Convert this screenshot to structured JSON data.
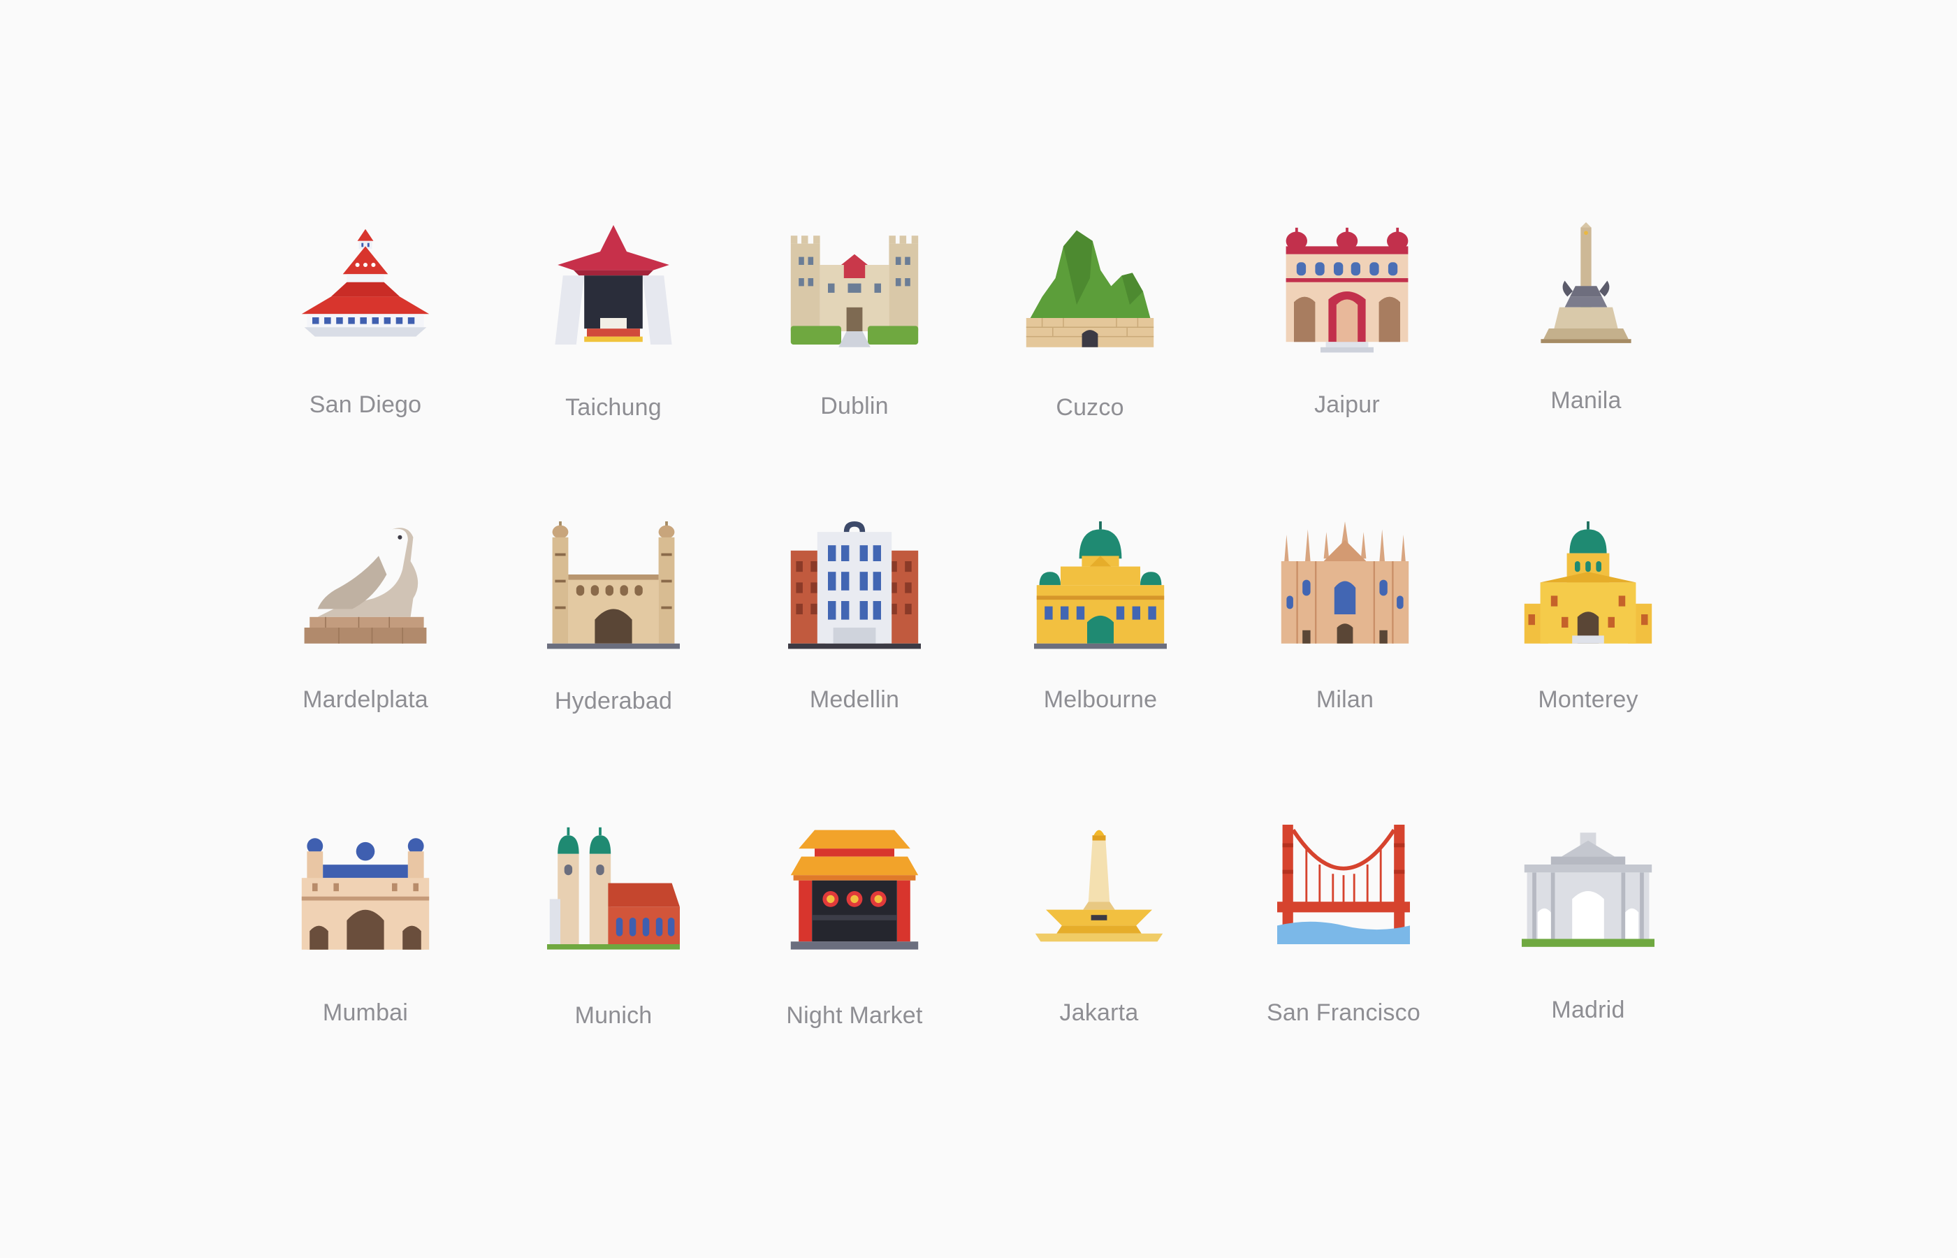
{
  "cities": [
    {
      "name": "San Diego",
      "icon": "san-diego-hotel-icon"
    },
    {
      "name": "Taichung",
      "icon": "taichung-pagoda-icon"
    },
    {
      "name": "Dublin",
      "icon": "dublin-castle-icon"
    },
    {
      "name": "Cuzco",
      "icon": "cuzco-machu-picchu-icon"
    },
    {
      "name": "Jaipur",
      "icon": "jaipur-palace-icon"
    },
    {
      "name": "Manila",
      "icon": "manila-rizal-monument-icon"
    },
    {
      "name": "Mardelplata",
      "icon": "mardelplata-sea-lion-icon"
    },
    {
      "name": "Hyderabad",
      "icon": "hyderabad-charminar-icon"
    },
    {
      "name": "Medellin",
      "icon": "medellin-building-icon"
    },
    {
      "name": "Melbourne",
      "icon": "melbourne-flinders-station-icon"
    },
    {
      "name": "Milan",
      "icon": "milan-cathedral-icon"
    },
    {
      "name": "Monterey",
      "icon": "monterey-church-icon"
    },
    {
      "name": "Mumbai",
      "icon": "mumbai-gateway-icon"
    },
    {
      "name": "Munich",
      "icon": "munich-frauenkirche-icon"
    },
    {
      "name": "Night Market",
      "icon": "night-market-gate-icon"
    },
    {
      "name": "Jakarta",
      "icon": "jakarta-monas-icon"
    },
    {
      "name": "San Francisco",
      "icon": "golden-gate-bridge-icon"
    },
    {
      "name": "Madrid",
      "icon": "madrid-puerta-de-alcala-icon"
    }
  ]
}
